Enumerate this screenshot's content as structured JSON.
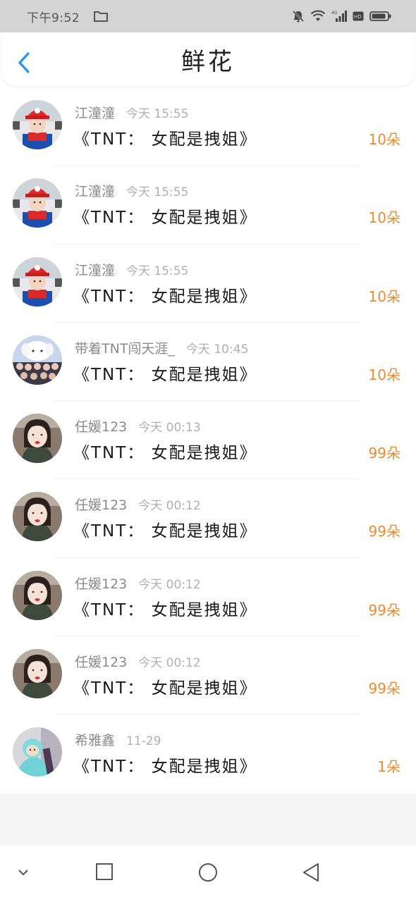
{
  "status": {
    "time": "下午9:52"
  },
  "header": {
    "title": "鲜花"
  },
  "items": [
    {
      "user": "江潼潼",
      "time": "今天 15:55",
      "book": "《TNT： 女配是拽姐》",
      "amount": "10朵",
      "avatar": "avatar-red-hat"
    },
    {
      "user": "江潼潼",
      "time": "今天 15:55",
      "book": "《TNT： 女配是拽姐》",
      "amount": "10朵",
      "avatar": "avatar-red-hat"
    },
    {
      "user": "江潼潼",
      "time": "今天 15:55",
      "book": "《TNT： 女配是拽姐》",
      "amount": "10朵",
      "avatar": "avatar-red-hat"
    },
    {
      "user": "带着TNT闯天涯_",
      "time": "今天 10:45",
      "book": "《TNT： 女配是拽姐》",
      "amount": "10朵",
      "avatar": "avatar-group"
    },
    {
      "user": "任媛123",
      "time": "今天 00:13",
      "book": "《TNT： 女配是拽姐》",
      "amount": "99朵",
      "avatar": "avatar-girl"
    },
    {
      "user": "任媛123",
      "time": "今天 00:12",
      "book": "《TNT： 女配是拽姐》",
      "amount": "99朵",
      "avatar": "avatar-girl"
    },
    {
      "user": "任媛123",
      "time": "今天 00:12",
      "book": "《TNT： 女配是拽姐》",
      "amount": "99朵",
      "avatar": "avatar-girl"
    },
    {
      "user": "任媛123",
      "time": "今天 00:12",
      "book": "《TNT： 女配是拽姐》",
      "amount": "99朵",
      "avatar": "avatar-girl"
    },
    {
      "user": "希雅鑫",
      "time": "11-29",
      "book": "《TNT： 女配是拽姐》",
      "amount": "1朵",
      "avatar": "avatar-teal"
    }
  ],
  "colors": {
    "accent": "#2196f3",
    "amount": "#f08a2e"
  }
}
